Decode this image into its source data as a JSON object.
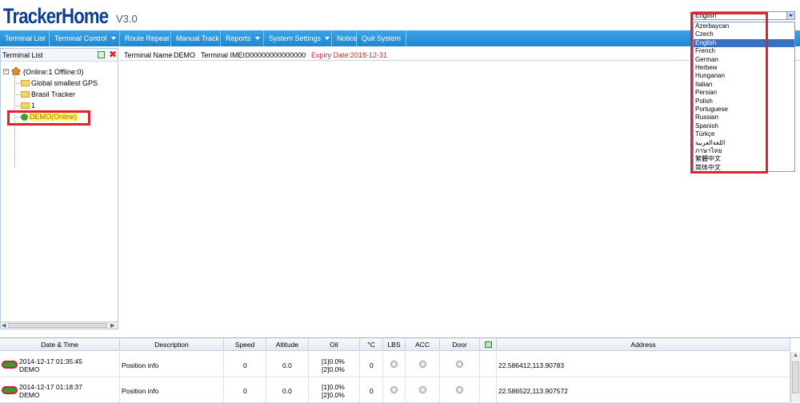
{
  "header": {
    "logo": "TrackerHome",
    "version": "V3.0"
  },
  "menu": [
    {
      "label": "Terminal List",
      "caret": false
    },
    {
      "label": "Terminal Control",
      "caret": true
    },
    {
      "label": "Route Repeat",
      "caret": false
    },
    {
      "label": "Manual Track",
      "caret": false
    },
    {
      "label": "Reports",
      "caret": true
    },
    {
      "label": "System Settings",
      "caret": true
    },
    {
      "label": "Notice",
      "caret": false
    },
    {
      "label": "Quit System",
      "caret": false
    }
  ],
  "left_panel": {
    "title": "Terminal List",
    "root": "(Online:1   Offline:0)",
    "groups": [
      "Global smallest GPS",
      "Brasil Tracker",
      "1"
    ],
    "device": "DEMO(Online)"
  },
  "infobar": {
    "name_label": "Terminal Name",
    "name_value": "DEMO",
    "imei_label": "Terminal IMEI:",
    "imei_value": "000000000000000",
    "expiry": "Expiry Date:2018-12-31"
  },
  "language": {
    "selected": "English",
    "options": [
      "Azerbaycan",
      "Czech",
      "English",
      "French",
      "German",
      "Herbew",
      "Hungarian",
      "Italian",
      "Persian",
      "Polish",
      "Portuguese",
      "Russian",
      "Spanish",
      "Türkçe",
      "اللغةالعربية",
      "ภาษาไทย",
      "繁體中文",
      "简体中文"
    ]
  },
  "table": {
    "headers": [
      "Date & Time",
      "Description",
      "Speed",
      "Altitude",
      "Oil",
      "°C",
      "LBS",
      "ACC",
      "Door",
      "",
      "Address"
    ],
    "rows": [
      {
        "datetime": "2014-12-17 01:35:45",
        "name": "DEMO",
        "description": "Position info",
        "speed": "0",
        "altitude": "0.0",
        "oil1": "[1]0.0%",
        "oil2": "[2]0.0%",
        "temp": "0",
        "address": "22.586412,113.90783"
      },
      {
        "datetime": "2014-12-17 01:18:37",
        "name": "DEMO",
        "description": "Position info",
        "speed": "0",
        "altitude": "0.0",
        "oil1": "[1]0.0%",
        "oil2": "[2]0.0%",
        "temp": "0",
        "address": "22.586522,113.907572"
      }
    ]
  },
  "colors": {
    "menu_bg": "#1f87d0",
    "logo": "#0d3f8f",
    "expiry": "#d0202a",
    "highlight_box": "#e0242f",
    "selected_option": "#3a6fc4"
  }
}
